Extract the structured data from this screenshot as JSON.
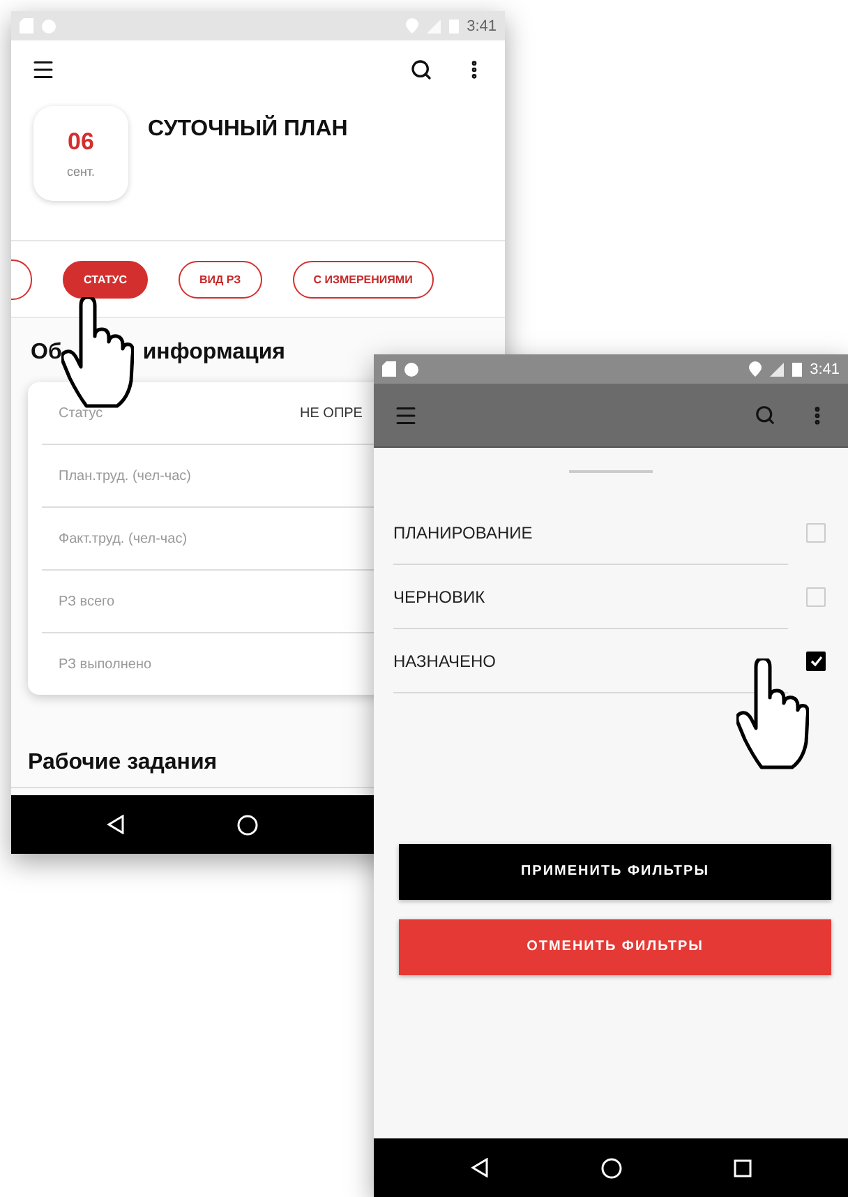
{
  "phone_main": {
    "status_bar": {
      "time": "3:41"
    },
    "title": "СУТОЧНЫЙ ПЛАН",
    "date": {
      "day": "06",
      "month": "сент."
    },
    "chips": [
      {
        "label": "СТАТУС",
        "selected": true
      },
      {
        "label": "ВИД РЗ",
        "selected": false
      },
      {
        "label": "С ИЗМЕРЕНИЯМИ",
        "selected": false
      }
    ],
    "info_title_parts": [
      "Об",
      "информация"
    ],
    "info_rows": [
      {
        "label": "Статус",
        "value": "НЕ ОПРЕ"
      },
      {
        "label": "План.труд. (чел-час)"
      },
      {
        "label": "Факт.труд. (чел-час)"
      },
      {
        "label": "РЗ всего"
      },
      {
        "label": "РЗ выполнено"
      }
    ],
    "section_title": "Рабочие задания"
  },
  "phone_filter": {
    "status_bar": {
      "time": "3:41"
    },
    "options": [
      {
        "label": "ПЛАНИРОВАНИЕ",
        "checked": false
      },
      {
        "label": "ЧЕРНОВИК",
        "checked": false
      },
      {
        "label": "НАЗНАЧЕНО",
        "checked": true
      }
    ],
    "buttons": [
      {
        "label": "ПРИМЕНИТЬ ФИЛЬТРЫ",
        "kind": "primary"
      },
      {
        "label": "ОТМЕНИТЬ ФИЛЬТРЫ",
        "kind": "danger"
      }
    ]
  }
}
